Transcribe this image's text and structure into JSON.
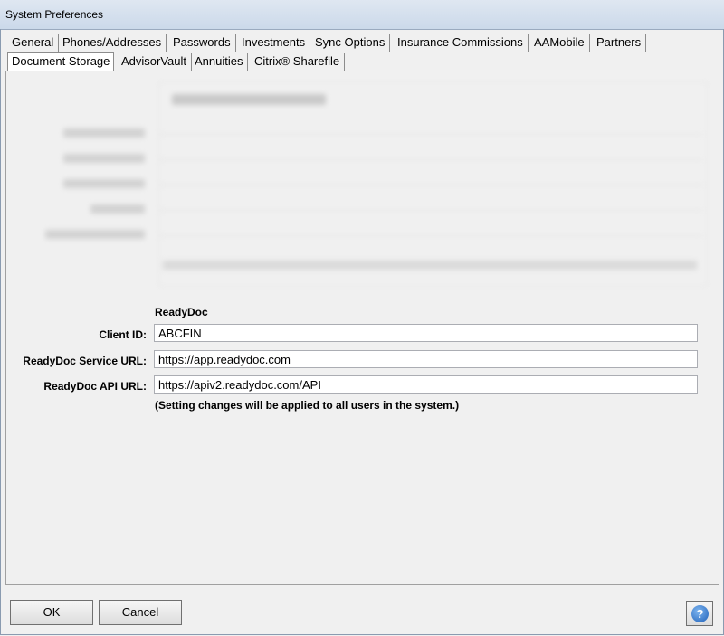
{
  "window": {
    "title": "System Preferences"
  },
  "tabs_row1": [
    "General",
    "Phones/Addresses",
    "Passwords",
    "Investments",
    "Sync Options",
    "Insurance Commissions",
    "AAMobile",
    "Partners"
  ],
  "tabs_row2": [
    "Document Storage",
    "AdvisorVault",
    "Annuities",
    "Citrix® Sharefile"
  ],
  "active_tab": "Document Storage",
  "readydoc": {
    "section_title": "ReadyDoc",
    "client_id_label": "Client ID:",
    "client_id_value": "ABCFIN",
    "service_url_label": "ReadyDoc Service URL:",
    "service_url_value": "https://app.readydoc.com",
    "api_url_label": "ReadyDoc API URL:",
    "api_url_value": "https://apiv2.readydoc.com/API",
    "note": "(Setting changes will be applied to all users in the system.)"
  },
  "buttons": {
    "ok": "OK",
    "cancel": "Cancel",
    "help": "?"
  },
  "icons": {
    "help": "help-icon"
  }
}
